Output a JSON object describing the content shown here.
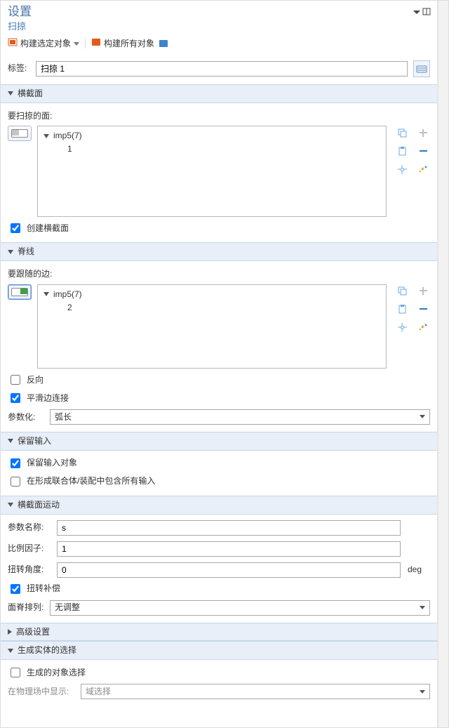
{
  "panel": {
    "title": "设置"
  },
  "command": {
    "name": "扫掠"
  },
  "toolbar": {
    "build_selected": "构建选定对象",
    "build_all": "构建所有对象"
  },
  "label_row": {
    "label": "标签:",
    "value": "扫掠 1"
  },
  "sections": {
    "cross_section": {
      "title": "横截面",
      "face_label": "要扫掠的面:",
      "tree": {
        "parent": "imp5(7)",
        "child": "1"
      },
      "create_cross_section": "创建横截面"
    },
    "spine": {
      "title": "脊线",
      "edge_label": "要跟随的边:",
      "tree": {
        "parent": "imp5(7)",
        "child": "2"
      },
      "reverse": "反向",
      "smooth_edges": "平滑边连接",
      "param_label": "参数化:",
      "param_value": "弧长"
    },
    "keep_input": {
      "title": "保留输入",
      "keep_objects": "保留输入对象",
      "include_all": "在形成联合体/装配中包含所有输入"
    },
    "motion": {
      "title": "横截面运动",
      "param_name_label": "参数名称:",
      "param_name_value": "s",
      "scale_label": "比例因子:",
      "scale_value": "1",
      "twist_label": "扭转角度:",
      "twist_value": "0",
      "twist_unit": "deg",
      "twist_comp": "扭转补偿",
      "face_spine_label": "面脊排列:",
      "face_spine_value": "无调整"
    },
    "advanced": {
      "title": "高级设置"
    },
    "result_sel": {
      "title": "生成实体的选择",
      "obj_sel": "生成的对象选择",
      "show_in_label": "在物理场中显示:",
      "show_in_value": "域选择"
    }
  }
}
